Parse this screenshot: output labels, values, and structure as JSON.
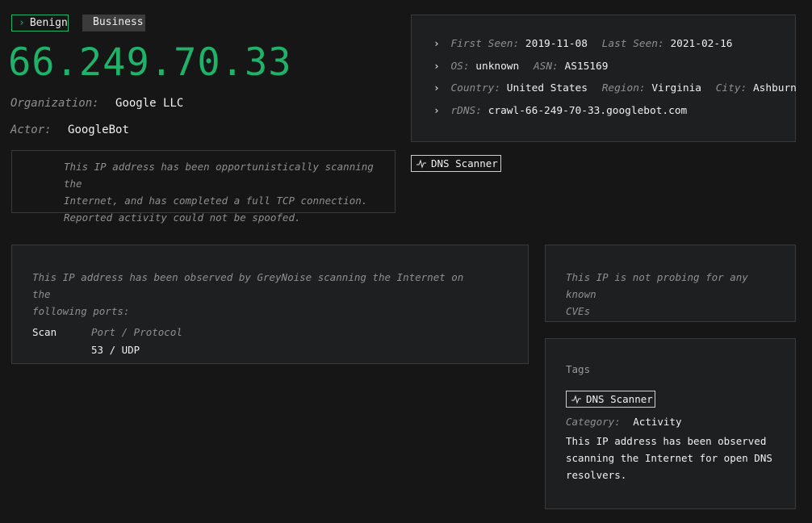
{
  "badges": {
    "classification": "Benign",
    "category": "Business"
  },
  "ip_address": "66.249.70.33",
  "organization": {
    "label": "Organization:",
    "value": "Google LLC"
  },
  "actor": {
    "label": "Actor:",
    "value": "GoogleBot"
  },
  "description": [
    "This IP address has been opportunistically scanning the",
    "Internet, and has completed a full TCP connection.",
    "Reported activity could not be spoofed."
  ],
  "info": {
    "first_seen_label": "First Seen:",
    "first_seen": "2019-11-08",
    "last_seen_label": "Last Seen:",
    "last_seen": "2021-02-16",
    "os_label": "OS:",
    "os": "unknown",
    "asn_label": "ASN:",
    "asn": "AS15169",
    "country_label": "Country:",
    "country": "United States",
    "region_label": "Region:",
    "region": "Virginia",
    "city_label": "City:",
    "city": "Ashburn",
    "rdns_label": "rDNS:",
    "rdns": "crawl-66-249-70-33.googlebot.com"
  },
  "header_tag": {
    "label": "DNS Scanner",
    "icon": "activity-icon"
  },
  "ports": {
    "intro": [
      "This IP address has been observed by GreyNoise scanning the Internet on the",
      "following ports:"
    ],
    "scan_label": "Scan",
    "column_header": "Port / Protocol",
    "rows": [
      "53 / UDP"
    ]
  },
  "cves": {
    "message": [
      "This IP is not probing for any known",
      "CVEs"
    ]
  },
  "tags": {
    "heading": "Tags",
    "tag_label": "DNS Scanner",
    "category_label": "Category:",
    "category_value": "Activity",
    "description": [
      "This IP address has been observed",
      "scanning the Internet for open DNS",
      "resolvers."
    ]
  },
  "colors": {
    "accent_green": "#1fb36a",
    "background": "#161616",
    "panel": "#1e1f20"
  }
}
